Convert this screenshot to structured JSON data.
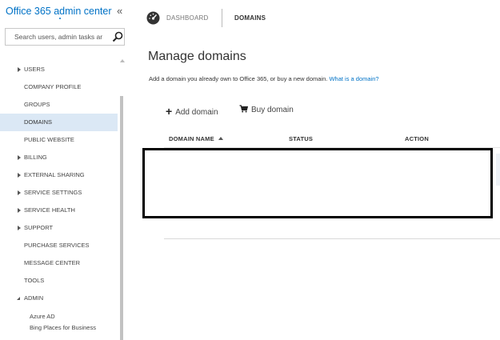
{
  "sidebar": {
    "title": "Office 365 admin center",
    "collapse_glyph": "«",
    "search_placeholder": "Search users, admin tasks ar",
    "nav": [
      {
        "label": "USERS",
        "expandable": true
      },
      {
        "label": "COMPANY PROFILE"
      },
      {
        "label": "GROUPS"
      },
      {
        "label": "DOMAINS",
        "selected": true
      },
      {
        "label": "PUBLIC WEBSITE"
      },
      {
        "label": "BILLING",
        "expandable": true
      },
      {
        "label": "EXTERNAL SHARING",
        "expandable": true
      },
      {
        "label": "SERVICE SETTINGS",
        "expandable": true
      },
      {
        "label": "SERVICE HEALTH",
        "expandable": true
      },
      {
        "label": "SUPPORT",
        "expandable": true
      },
      {
        "label": "PURCHASE SERVICES"
      },
      {
        "label": "MESSAGE CENTER"
      },
      {
        "label": "TOOLS"
      },
      {
        "label": "ADMIN",
        "expanded": true
      }
    ],
    "admin_sub": [
      "Azure AD",
      "Bing Places for Business"
    ]
  },
  "breadcrumb": {
    "dashboard": "DASHBOARD",
    "current": "DOMAINS"
  },
  "main": {
    "title": "Manage domains",
    "description": "Add a domain you already own to Office 365, or buy a new domain.",
    "link": "What is a domain?",
    "add_domain": "Add domain",
    "buy_domain": "Buy domain"
  },
  "table": {
    "columns": [
      "DOMAIN NAME",
      "STATUS",
      "ACTION"
    ]
  },
  "colors": {
    "accent": "#0072c6",
    "selected_bg": "#dbe8f5"
  }
}
